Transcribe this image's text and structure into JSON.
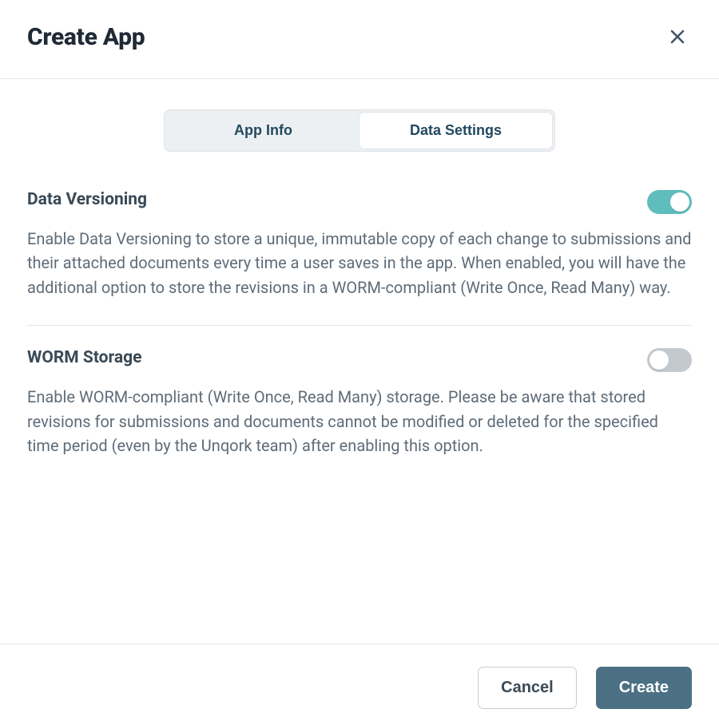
{
  "header": {
    "title": "Create App"
  },
  "tabs": {
    "app_info": "App Info",
    "data_settings": "Data Settings",
    "active": "data_settings"
  },
  "settings": {
    "data_versioning": {
      "title": "Data Versioning",
      "description": "Enable Data Versioning to store a unique, immutable copy of each change to submissions and their attached documents every time a user saves in the app. When enabled, you will have the additional option to store the revisions in a WORM-compliant (Write Once, Read Many) way.",
      "enabled": true
    },
    "worm_storage": {
      "title": "WORM Storage",
      "description": "Enable WORM-compliant (Write Once, Read Many) storage. Please be aware that stored revisions for submissions and documents cannot be modified or deleted for the specified time period (even by the Unqork team) after enabling this option.",
      "enabled": false
    }
  },
  "footer": {
    "cancel": "Cancel",
    "create": "Create"
  }
}
